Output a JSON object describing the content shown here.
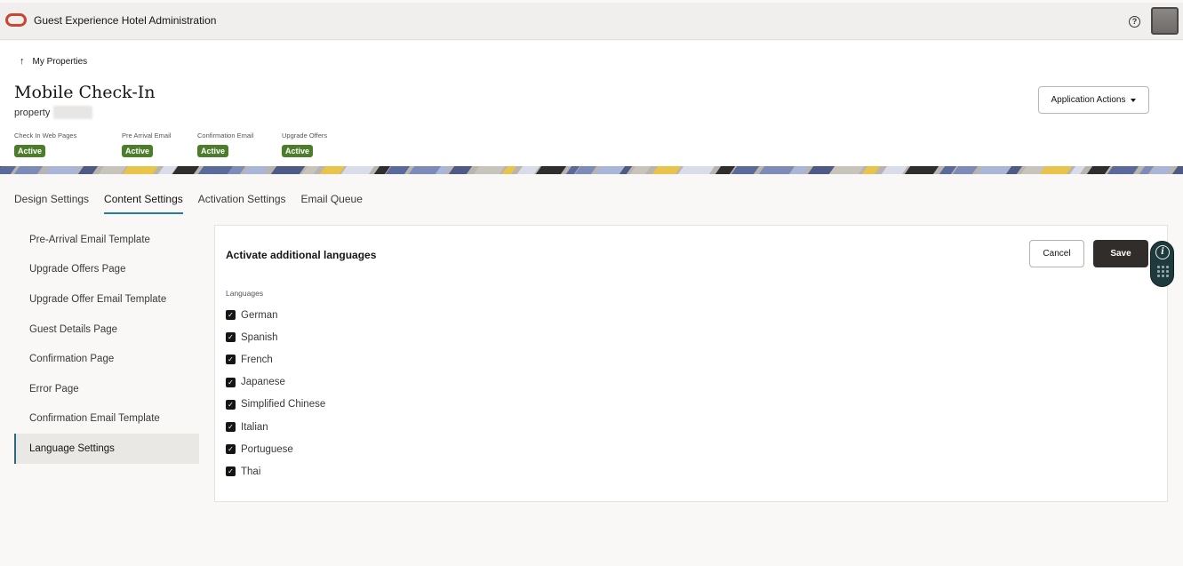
{
  "topbar": {
    "app_title": "Guest Experience Hotel Administration",
    "logo_icon": "oracle-logo-icon",
    "help_icon": "help-icon",
    "help_glyph": "?",
    "avatar": "user-avatar"
  },
  "header": {
    "back_arrow": "↑",
    "back_label": "My Properties",
    "title": "Mobile Check-In",
    "subtitle": "property",
    "application_actions_label": "Application Actions",
    "statuses": [
      {
        "label": "Check In Web Pages",
        "badge": "Active"
      },
      {
        "label": "Pre Arrival Email",
        "badge": "Active"
      },
      {
        "label": "Confirmation Email",
        "badge": "Active"
      },
      {
        "label": "Upgrade Offers",
        "badge": "Active"
      }
    ],
    "badge_color": "#4c7d2a"
  },
  "tabs": [
    {
      "label": "Design Settings",
      "active": false
    },
    {
      "label": "Content Settings",
      "active": true
    },
    {
      "label": "Activation Settings",
      "active": false
    },
    {
      "label": "Email Queue",
      "active": false
    }
  ],
  "sidenav": {
    "items": [
      {
        "label": "Pre-Arrival Email Template",
        "active": false
      },
      {
        "label": "Upgrade Offers Page",
        "active": false
      },
      {
        "label": "Upgrade Offer Email Template",
        "active": false
      },
      {
        "label": "Guest Details Page",
        "active": false
      },
      {
        "label": "Confirmation Page",
        "active": false
      },
      {
        "label": "Error Page",
        "active": false
      },
      {
        "label": "Confirmation Email Template",
        "active": false
      },
      {
        "label": "Language Settings",
        "active": true
      }
    ]
  },
  "panel": {
    "title": "Activate additional languages",
    "cancel_label": "Cancel",
    "save_label": "Save",
    "field_label": "Languages",
    "languages": [
      {
        "label": "German",
        "checked": true
      },
      {
        "label": "Spanish",
        "checked": true
      },
      {
        "label": "French",
        "checked": true
      },
      {
        "label": "Japanese",
        "checked": true
      },
      {
        "label": "Simplified Chinese",
        "checked": true
      },
      {
        "label": "Italian",
        "checked": true
      },
      {
        "label": "Portuguese",
        "checked": true
      },
      {
        "label": "Thai",
        "checked": true
      }
    ],
    "check_glyph": "✓"
  },
  "help_widget": {
    "info_glyph": "i"
  },
  "colors": {
    "accent": "#227e9e",
    "save_button": "#312d2a",
    "logo": "#c74634"
  }
}
